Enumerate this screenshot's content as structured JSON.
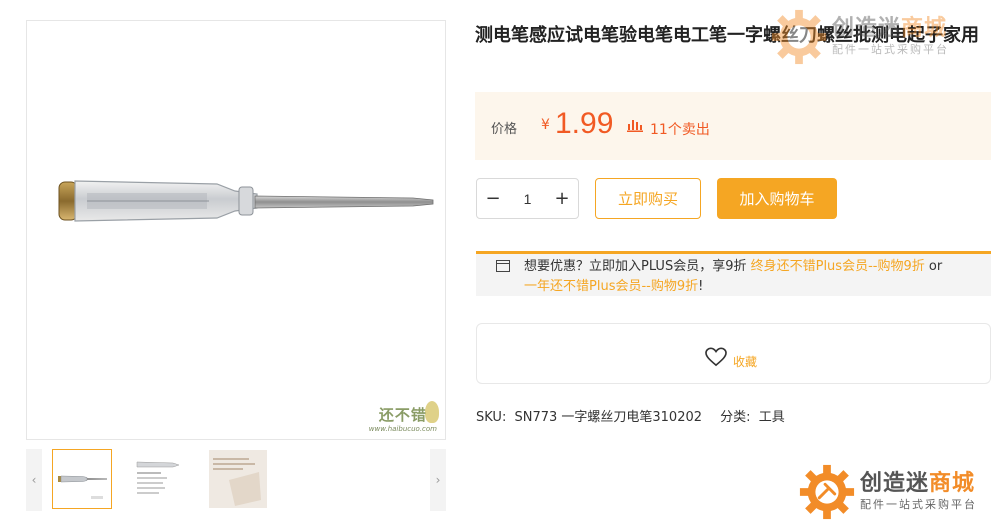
{
  "gallery": {
    "main_watermark": {
      "name": "还不错",
      "url": "www.haibucuo.com"
    },
    "prev_icon": "chevron-left-icon",
    "next_icon": "chevron-right-icon",
    "thumbnails": [
      {
        "name": "thumbnail-screwdriver",
        "active": true
      },
      {
        "name": "thumbnail-packaging",
        "active": false
      },
      {
        "name": "thumbnail-label",
        "active": false
      }
    ]
  },
  "product": {
    "title": "测电笔感应试电笔验电笔电工笔一字螺丝刀螺丝批测电起子家用"
  },
  "price": {
    "label": "价格",
    "currency": "¥",
    "value": "1.99",
    "sales_icon": "bar-chart-icon",
    "sales_text": "11个卖出"
  },
  "purchase": {
    "minus": "−",
    "quantity": "1",
    "plus": "+",
    "buy_now": "立即购买",
    "add_to_cart": "加入购物车"
  },
  "plus_promo": {
    "icon": "card-icon",
    "text_before": "想要优惠？立即加入PLUS会员，享9折 ",
    "link1": "终身还不错Plus会员--购物9折",
    "or_text": " or",
    "link2": "一年还不错Plus会员--购物9折",
    "end": "!"
  },
  "favorite": {
    "icon": "heart-icon",
    "label": "收藏"
  },
  "meta": {
    "sku_label": "SKU:",
    "sku_value": "SN773 一字螺丝刀电笔310202",
    "category_label": "分类:",
    "category_value": "工具"
  },
  "brand": {
    "name_part1": "创造迷",
    "name_part2": "商城",
    "tagline": "配件一站式采购平台",
    "accent_color": "#f28c28"
  },
  "colors": {
    "primary": "#f5a623",
    "price": "#f15a24",
    "price_bg": "#fdf6ec"
  }
}
